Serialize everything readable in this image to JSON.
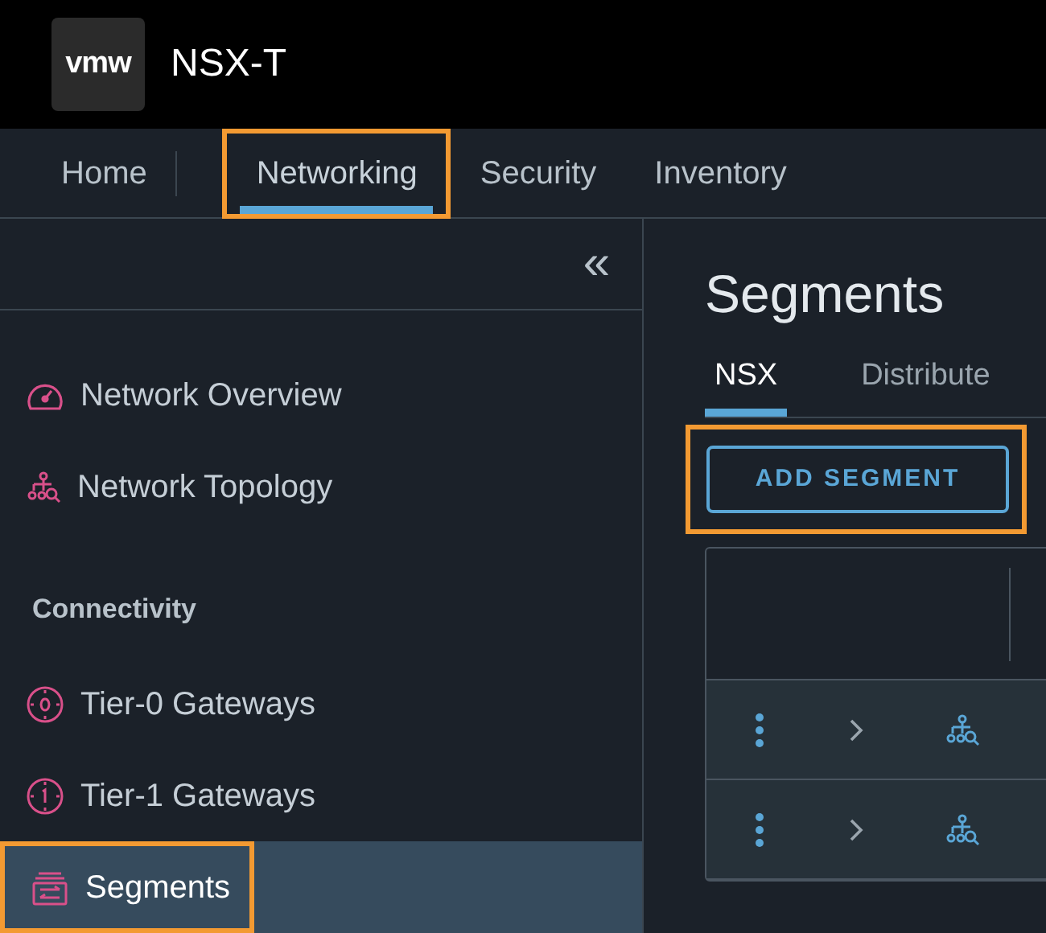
{
  "header": {
    "logo": "vmw",
    "product": "NSX-T"
  },
  "nav_tabs": [
    {
      "label": "Home",
      "selected": false,
      "highlighted": false
    },
    {
      "label": "Networking",
      "selected": true,
      "highlighted": true
    },
    {
      "label": "Security",
      "selected": false,
      "highlighted": false
    },
    {
      "label": "Inventory",
      "selected": false,
      "highlighted": false
    }
  ],
  "sidebar": {
    "collapse": "«",
    "items": [
      {
        "kind": "item",
        "label": "Network Overview",
        "selected": false,
        "highlighted": false
      },
      {
        "kind": "item",
        "label": "Network Topology",
        "selected": false,
        "highlighted": false
      },
      {
        "kind": "heading",
        "label": "Connectivity"
      },
      {
        "kind": "item",
        "label": "Tier-0 Gateways",
        "selected": false,
        "highlighted": false
      },
      {
        "kind": "item",
        "label": "Tier-1 Gateways",
        "selected": false,
        "highlighted": false
      },
      {
        "kind": "item",
        "label": "Segments",
        "selected": true,
        "highlighted": true
      }
    ]
  },
  "main": {
    "title": "Segments",
    "tabs": [
      {
        "label": "NSX",
        "selected": true
      },
      {
        "label": "Distribute",
        "selected": false
      }
    ],
    "add_button": {
      "label": "ADD SEGMENT",
      "highlighted": true
    },
    "table": {
      "rows": [
        {
          "expanded": false
        },
        {
          "expanded": false
        }
      ]
    }
  }
}
